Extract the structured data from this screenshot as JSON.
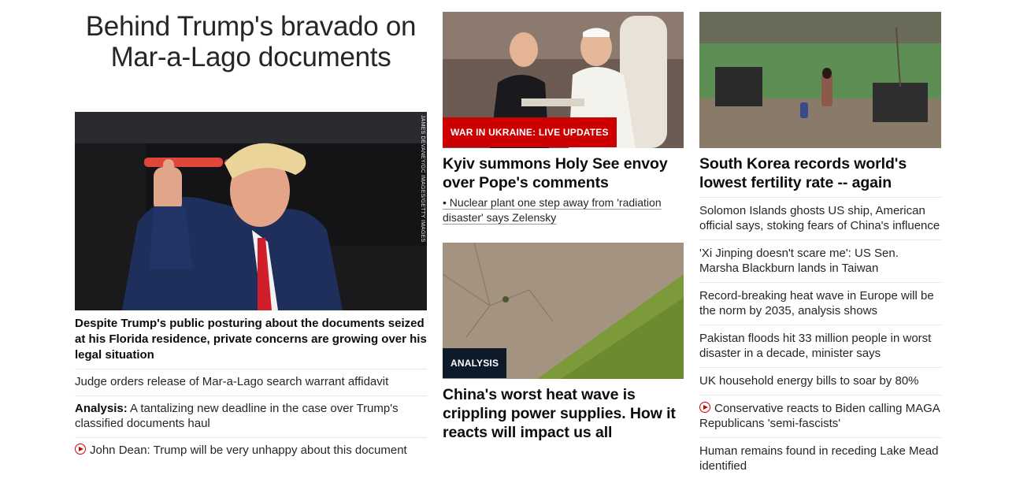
{
  "lead": {
    "title": "Behind Trump's bravado on Mar-a-Lago documents",
    "image_credit": "JAMES DEVANEY/GC IMAGES/GETTY IMAGES",
    "description": "Despite Trump's public posturing about the documents seized at his Florida residence, private concerns are growing over his legal situation",
    "related": [
      {
        "prefix": "",
        "text": "Judge orders release of Mar-a-Lago search warrant affidavit",
        "video": false
      },
      {
        "prefix": "Analysis:",
        "text": " A tantalizing new deadline in the case over Trump's classified documents haul",
        "video": false
      },
      {
        "prefix": "",
        "text": "John Dean: Trump will be very unhappy about this document",
        "video": true
      }
    ]
  },
  "story_ukraine": {
    "tag": "WAR IN UKRAINE: LIVE UPDATES",
    "headline": "Kyiv summons Holy See envoy over Pope's comments",
    "bullet": "• Nuclear plant one step away from 'radiation disaster' says Zelensky"
  },
  "story_china": {
    "tag": "ANALYSIS",
    "headline": "China's worst heat wave is crippling power supplies. How it reacts will impact us all"
  },
  "story_korea": {
    "headline": "South Korea records world's lowest fertility rate -- again",
    "links": [
      {
        "text": "Solomon Islands ghosts US ship, American official says, stoking fears of China's influence",
        "video": false
      },
      {
        "text": "'Xi Jinping doesn't scare me': US Sen. Marsha Blackburn lands in Taiwan",
        "video": false
      },
      {
        "text": "Record-breaking heat wave in Europe will be the norm by 2035, analysis shows",
        "video": false
      },
      {
        "text": "Pakistan floods hit 33 million people in worst disaster in a decade, minister says",
        "video": false
      },
      {
        "text": "UK household energy bills to soar by 80%",
        "video": false
      },
      {
        "text": "Conservative reacts to Biden calling MAGA Republicans 'semi-fascists'",
        "video": true
      },
      {
        "text": "Human remains found in receding Lake Mead identified",
        "video": false
      }
    ]
  },
  "colors": {
    "brand_red": "#cc0000",
    "analysis_tag": "#0c1a29",
    "divider": "#e6e6e6"
  }
}
